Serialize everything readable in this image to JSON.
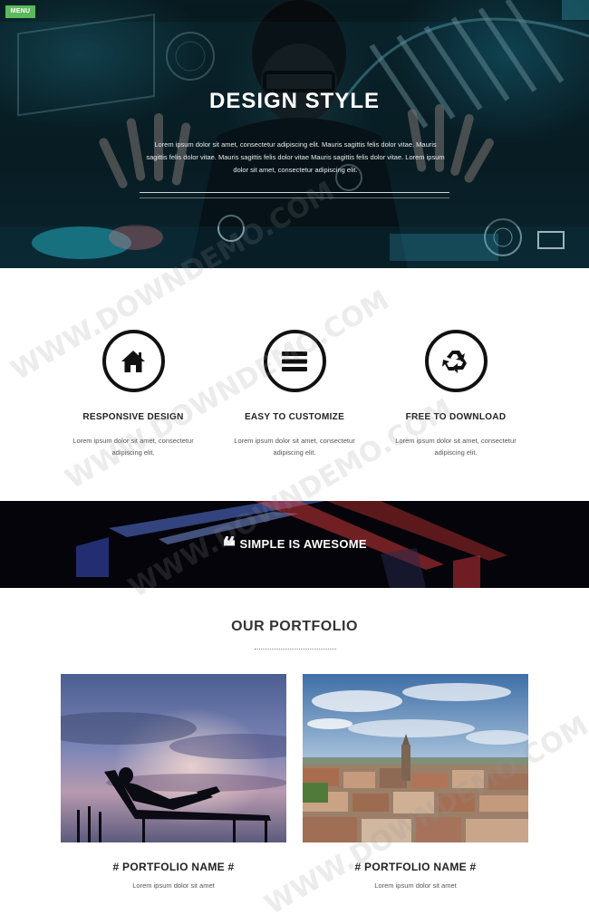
{
  "header": {
    "menu_label": "MENU"
  },
  "hero": {
    "title": "DESIGN STYLE",
    "text": "Lorem ipsum dolor sit amet, consectetur adipiscing elit. Mauris sagittis felis dolor vitae. Mauris sagittis felis dolor vitae. Mauris sagittis felis dolor vitae Mauris sagittis felis dolor vitae. Lorem ipsum dolor sit amet, consectetur adipiscing elit."
  },
  "features": [
    {
      "icon": "home-icon",
      "title": "RESPONSIVE DESIGN",
      "text": "Lorem ipsum dolor sit amet, consectetur adipiscing elit."
    },
    {
      "icon": "menu-bars-icon",
      "title": "EASY TO CUSTOMIZE",
      "text": "Lorem ipsum dolor sit amet, consectetur adipiscing elit."
    },
    {
      "icon": "recycle-icon",
      "title": "FREE TO DOWNLOAD",
      "text": "Lorem ipsum dolor sit amet, consectetur adipiscing elit."
    }
  ],
  "quote": {
    "text": "SIMPLE IS AWESOME"
  },
  "portfolio": {
    "title": "OUR PORTFOLIO",
    "items": [
      {
        "name": "# PORTFOLIO NAME #",
        "text": "Lorem ipsum dolor sit amet"
      },
      {
        "name": "# PORTFOLIO NAME #",
        "text": "Lorem ipsum dolor sit amet"
      }
    ]
  },
  "watermark": {
    "text": "WWW.DOWNDEMO.COM"
  },
  "colors": {
    "menu_button": "#5cb85c",
    "hero_bg": "#0a1f27",
    "quote_bg": "#04040a"
  }
}
